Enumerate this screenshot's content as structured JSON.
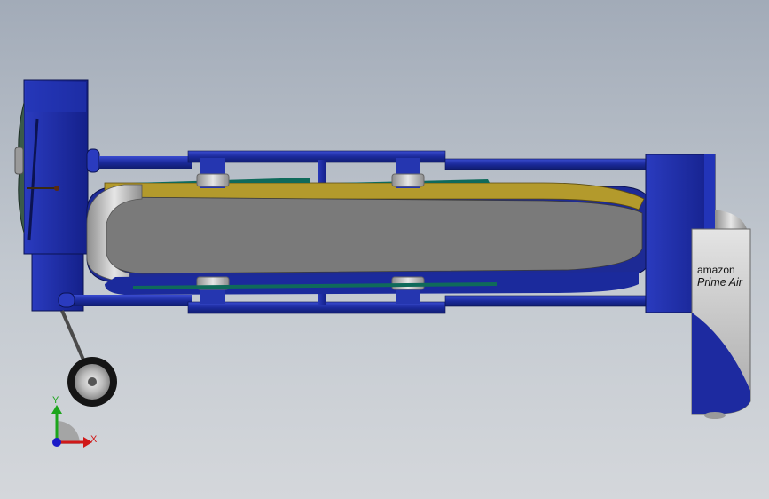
{
  "viewport": {
    "background_top": "#a2abb8",
    "background_bottom": "#d4d7db"
  },
  "model": {
    "label_line1": "amazon",
    "label_line2": "Prime Air",
    "colors": {
      "frame_blue": "#1b2a9c",
      "body_grey": "#7a7a7a",
      "body_yellow": "#b39a2c",
      "metal_light": "#c9c9c9"
    }
  },
  "triad": {
    "y_label": "Y",
    "x_label": "X",
    "y_color": "#1ca51c",
    "x_color": "#d01818",
    "z_color": "#1a1ac8"
  }
}
